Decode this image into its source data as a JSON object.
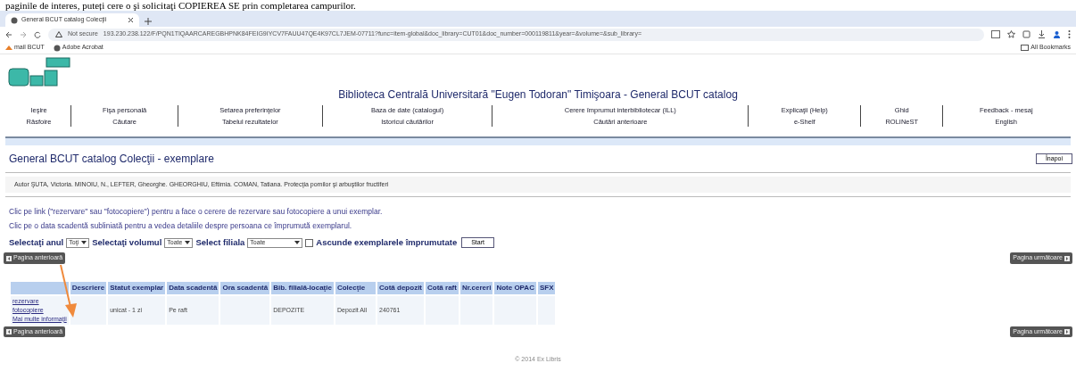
{
  "document_text": "paginile de interes, puteți cere o şi solicitaţi COPIEREA SE prin completarea campurilor.",
  "browser": {
    "tab_title": "General BCUT catalog Colecţii",
    "security": "Not secure",
    "url": "193.230.238.122/F/PQN1TIQAARCAREGBHPNK84FEIG9IYCV7FAUU47QE4K97CL7JEM-07711?func=item-global&doc_library=CUT01&doc_number=000119811&year=&volume=&sub_library=",
    "bookmarks": [
      "mail BCUT",
      "Adobe Acrobat"
    ],
    "all_bookmarks": "All Bookmarks"
  },
  "header": {
    "title": "Biblioteca Centrală Universitară \"Eugen Todoran\" Timişoara - General BCUT catalog",
    "nav_rows": [
      [
        "Ieşire",
        "Fişa personală",
        "Setarea preferinţelor",
        "Baza de date (catalogul)",
        "Cerere împrumut interbibliotecar (ILL)",
        "Explicaţii (Help)",
        "Ghid",
        "Feedback - mesaj"
      ],
      [
        "Răsfoire",
        "Căutare",
        "Tabelul rezultatelor",
        "Istoricul căutărilor",
        "Căutări anterioare",
        "e-Shelf",
        "ROLINeST",
        "English"
      ]
    ]
  },
  "page": {
    "heading": "General BCUT catalog Colecţii - exemplare",
    "back_button": "Înapoi",
    "record": "Autor ŞUTA, Victoria. MINOIU, N., LEFTER, Gheorghe. GHEORGHIU, Eftimia. COMAN, Tatiana. Protecţia pomilor şi arbuştilor fructiferi",
    "instructions": [
      "Clic pe link (\"rezervare\" sau \"fotocopiere\") pentru a face o cerere de rezervare sau fotocopiere a unui exemplar.",
      "Clic pe o data scadentă subliniată pentru a vedea detaliile despre persoana ce împrumută exemplarul."
    ],
    "filters": [
      {
        "kind": "select",
        "label": "Selectaţi anul",
        "value": "Toţi"
      },
      {
        "kind": "select",
        "label": "Selectaţi volumul",
        "value": "Toate"
      },
      {
        "kind": "select",
        "label": "Select filiala",
        "value": "Toate"
      },
      {
        "kind": "checkbox",
        "label": "Ascunde exemplarele împrumutate",
        "checked": false
      }
    ],
    "start_button": "Start",
    "pagination_top": {
      "prev_page": "Pagina anterioară",
      "next_page": "Pagina următoare"
    },
    "table": {
      "columns": [
        "Descriere",
        "Statut exemplar",
        "Data scadentă",
        "Ora scadentă",
        "Bib. filială-locaţie",
        "Colecţie",
        "Cotă depozit",
        "Cotă raft",
        "Nr.cereri",
        "Note OPAC",
        "SFX"
      ],
      "rows": [
        {
          "links": [
            "rezervare",
            "fotocopiere",
            "Mai multe informaţii"
          ],
          "cells": [
            null,
            "unicat - 1 zi",
            "Pe raft",
            null,
            "DEPOZITE",
            "Depozit All",
            "240761",
            null,
            null,
            null,
            null
          ]
        }
      ]
    },
    "pagination_bottom": {
      "prev_page": "Pagina anterioară",
      "next_page": "Pagina următoare"
    },
    "footer": "© 2014 Ex Libris"
  }
}
